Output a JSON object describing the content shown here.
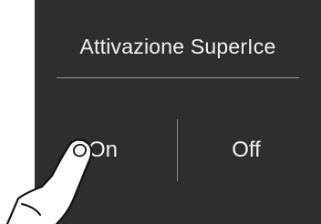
{
  "dialog": {
    "title": "Attivazione SuperIce",
    "options": [
      {
        "label": "On",
        "selected": true
      },
      {
        "label": "Off",
        "selected": false
      }
    ]
  },
  "colors": {
    "panel_background": "#2e2e2e",
    "text": "#f2f2f2",
    "divider": "#9a9a9a",
    "page_background": "#ffffff"
  },
  "overlay": {
    "icon": "pointing-finger-icon"
  }
}
